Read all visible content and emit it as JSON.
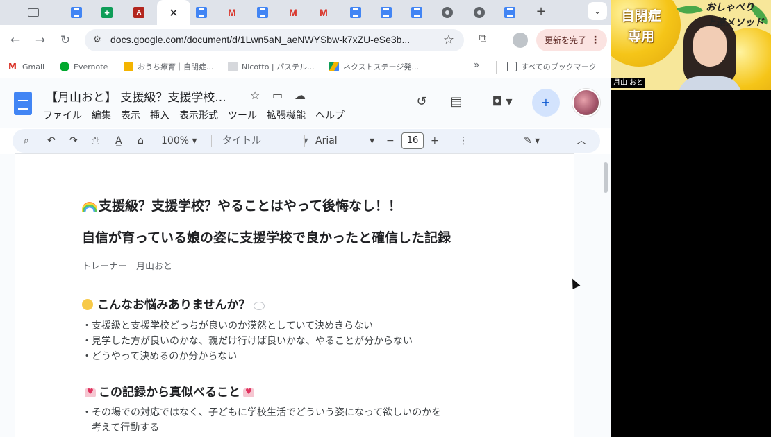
{
  "browser": {
    "update_button": "更新を完了",
    "url": "docs.google.com/document/d/1Lwn5aN_aeNWYSbw-k7xZU-eSe3b...",
    "tabs": [
      {
        "icon": "screen-icon"
      },
      {
        "icon": "docs-icon"
      },
      {
        "icon": "sheets-icon",
        "glyph": "+"
      },
      {
        "icon": "acrobat-icon",
        "glyph": "A"
      },
      {
        "icon": "close-icon",
        "active": true
      },
      {
        "icon": "docs-icon"
      },
      {
        "icon": "gmail-icon"
      },
      {
        "icon": "docs-icon"
      },
      {
        "icon": "gmail-icon"
      },
      {
        "icon": "gmail-icon"
      },
      {
        "icon": "docs-icon"
      },
      {
        "icon": "docs-icon"
      },
      {
        "icon": "docs-icon"
      },
      {
        "icon": "chrome-icon"
      },
      {
        "icon": "chrome-icon"
      },
      {
        "icon": "docs-icon"
      }
    ],
    "bookmarks": [
      {
        "label": "Gmail",
        "icon": "gmail-icon"
      },
      {
        "label": "Evernote",
        "icon": "evernote-icon"
      },
      {
        "label": "おうち療育｜自閉症...",
        "icon": "home-icon"
      },
      {
        "label": "Nicotto | パステル...",
        "icon": "page-icon"
      },
      {
        "label": "ネクストステージ発...",
        "icon": "drive-icon"
      }
    ],
    "bookmarks_all": "すべてのブックマーク"
  },
  "docs": {
    "title": "【月山おと】 支援級？支援学校...",
    "menu": [
      "ファイル",
      "編集",
      "表示",
      "挿入",
      "表示形式",
      "ツール",
      "拡張機能",
      "ヘルプ"
    ],
    "toolbar": {
      "zoom": "100%",
      "style": "タイトル",
      "font": "Arial",
      "font_size": "16"
    }
  },
  "document": {
    "heading1": "支援級？支援学校？やることはやって後悔なし！！",
    "heading1b": "自信が育っている娘の姿に支援学校で良かったと確信した記録",
    "author": "トレーナー　月山おと",
    "section1_title": "こんなお悩みありませんか？",
    "section1_items": [
      "・支援級と支援学校どっちが良いのか漠然としていて決めきらない",
      "・見学した方が良いのかな、親だけ行けば良いかな、やることが分からない",
      "・どうやって決めるのか分からない"
    ],
    "section2_title": "この記録から真似べること",
    "section2_items": [
      "・その場での対応ではなく、子どもに学校生活でどういう姿になって欲しいのかを",
      "　考えて行動する"
    ]
  },
  "video": {
    "banner_left": "自閉症\n専用",
    "banner_right": "おしゃべり\n上達メソッド",
    "name_tag": "月山 おと"
  },
  "colors": {
    "tab_strip": "#dfe3ea",
    "docs_blue": "#4285f4",
    "toolbar_bg": "#edf2fa",
    "update_chip": "#fbe3e1"
  }
}
